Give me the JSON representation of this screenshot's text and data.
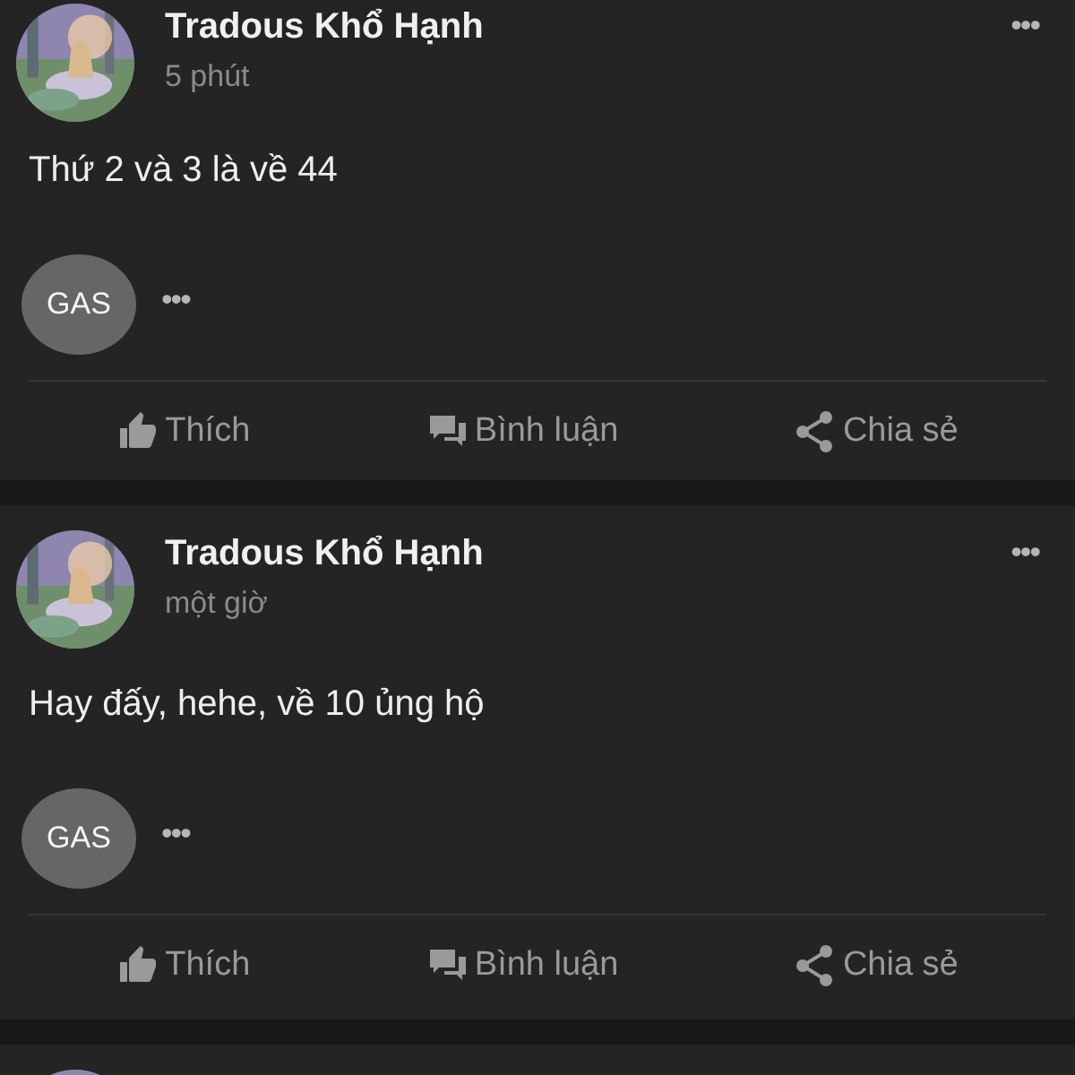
{
  "posts": [
    {
      "author": "Tradous Khổ Hạnh",
      "time": "5 phút",
      "more": "•••",
      "text": "Thứ 2 và 3 là về 44",
      "reactor": "GAS",
      "reactor_more": "•••",
      "actions": [
        {
          "kind": "like",
          "label": "Thích"
        },
        {
          "kind": "comment",
          "label": "Bình luận"
        },
        {
          "kind": "share",
          "label": "Chia sẻ"
        }
      ]
    },
    {
      "author": "Tradous Khổ Hạnh",
      "time": "một giờ",
      "more": "•••",
      "text": "Hay đấy, hehe, về 10 ủng hộ",
      "reactor": "GAS",
      "reactor_more": "•••",
      "actions": [
        {
          "kind": "like",
          "label": "Thích"
        },
        {
          "kind": "comment",
          "label": "Bình luận"
        },
        {
          "kind": "share",
          "label": "Chia sẻ"
        }
      ]
    }
  ]
}
